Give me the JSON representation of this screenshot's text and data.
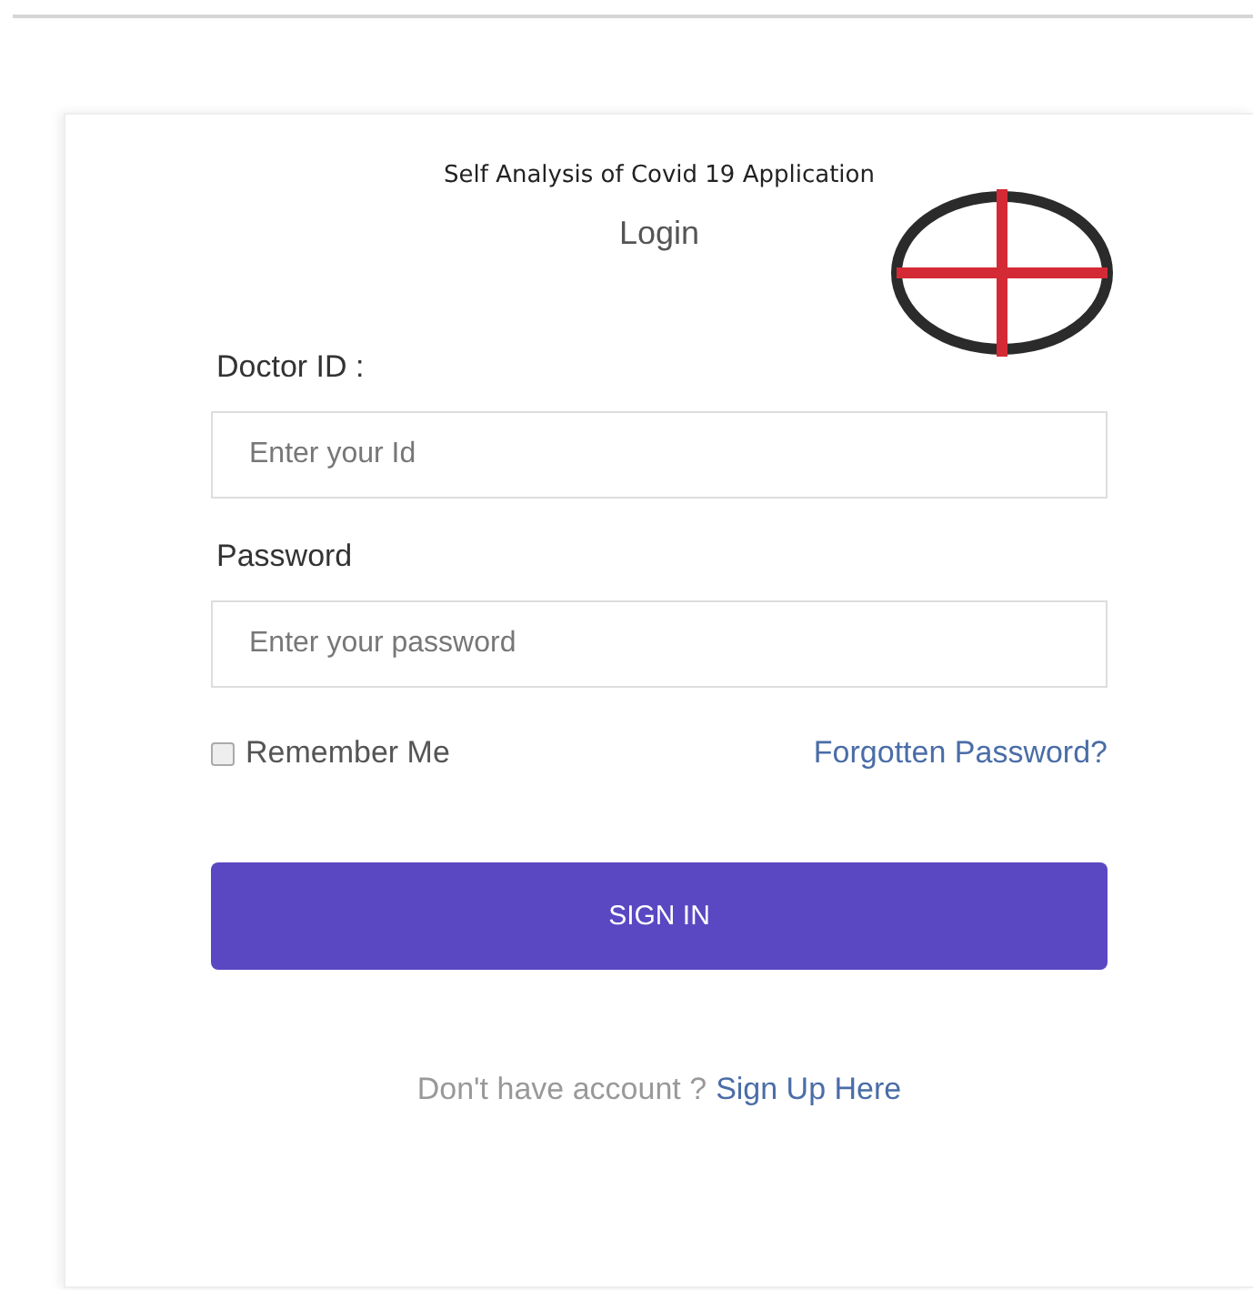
{
  "app_title": "Self Analysis of Covid 19 Application",
  "heading": "Login",
  "fields": [
    {
      "label": "Doctor ID :",
      "placeholder": "Enter your Id"
    },
    {
      "label": "Password",
      "placeholder": "Enter your password"
    }
  ],
  "remember": {
    "label": "Remember Me",
    "checked": false
  },
  "forgot_link": "Forgotten Password?",
  "submit": "SIGN IN",
  "footer": {
    "text": "Don't have account ?",
    "link": "Sign Up Here"
  }
}
